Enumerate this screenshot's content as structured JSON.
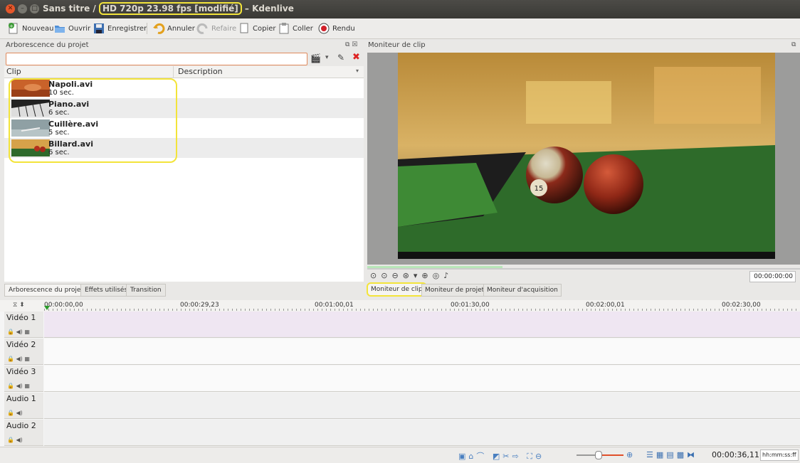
{
  "window": {
    "title_prefix": "Sans titre /",
    "title_profile": "HD 720p 23.98 fps [modifié]",
    "title_suffix": "– Kdenlive"
  },
  "toolbar": {
    "new": "Nouveau",
    "open": "Ouvrir",
    "save": "Enregistrer",
    "undo": "Annuler",
    "redo": "Refaire",
    "copy": "Copier",
    "paste": "Coller",
    "render": "Rendu"
  },
  "project_tree": {
    "title": "Arborescence du projet",
    "search_value": "",
    "col_clip": "Clip",
    "col_description": "Description",
    "clips": [
      {
        "name": "Napoli.avi",
        "duration": "10 sec."
      },
      {
        "name": "Piano.avi",
        "duration": "6 sec."
      },
      {
        "name": "Cuillère.avi",
        "duration": "5 sec."
      },
      {
        "name": "Billard.avi",
        "duration": "6 sec."
      }
    ]
  },
  "left_tabs": [
    "Arborescence du projet",
    "Effets utilisés",
    "Transition"
  ],
  "monitor": {
    "title": "Moniteur de clip",
    "timecode": "00:00:00:00",
    "tabs": [
      "Moniteur de clip",
      "Moniteur de projet",
      "Moniteur d'acquisition"
    ]
  },
  "timeline": {
    "ruler": [
      "00:00:00,00",
      "00:00:29,23",
      "00:01:00,01",
      "00:01:30,00",
      "00:02:00,01",
      "00:02:30,00"
    ],
    "tracks": [
      {
        "name": "Vidéo 1",
        "type": "video"
      },
      {
        "name": "Vidéo 2",
        "type": "video"
      },
      {
        "name": "Vidéo 3",
        "type": "video"
      },
      {
        "name": "Audio 1",
        "type": "audio"
      },
      {
        "name": "Audio 2",
        "type": "audio"
      }
    ]
  },
  "status": {
    "duration": "00:00:36,11",
    "timecode_format": "hh:mm:ss:ff"
  },
  "colors": {
    "highlight": "#f3e43a",
    "track_selected": "#efe6f2",
    "search_border": "#e08a5c"
  }
}
